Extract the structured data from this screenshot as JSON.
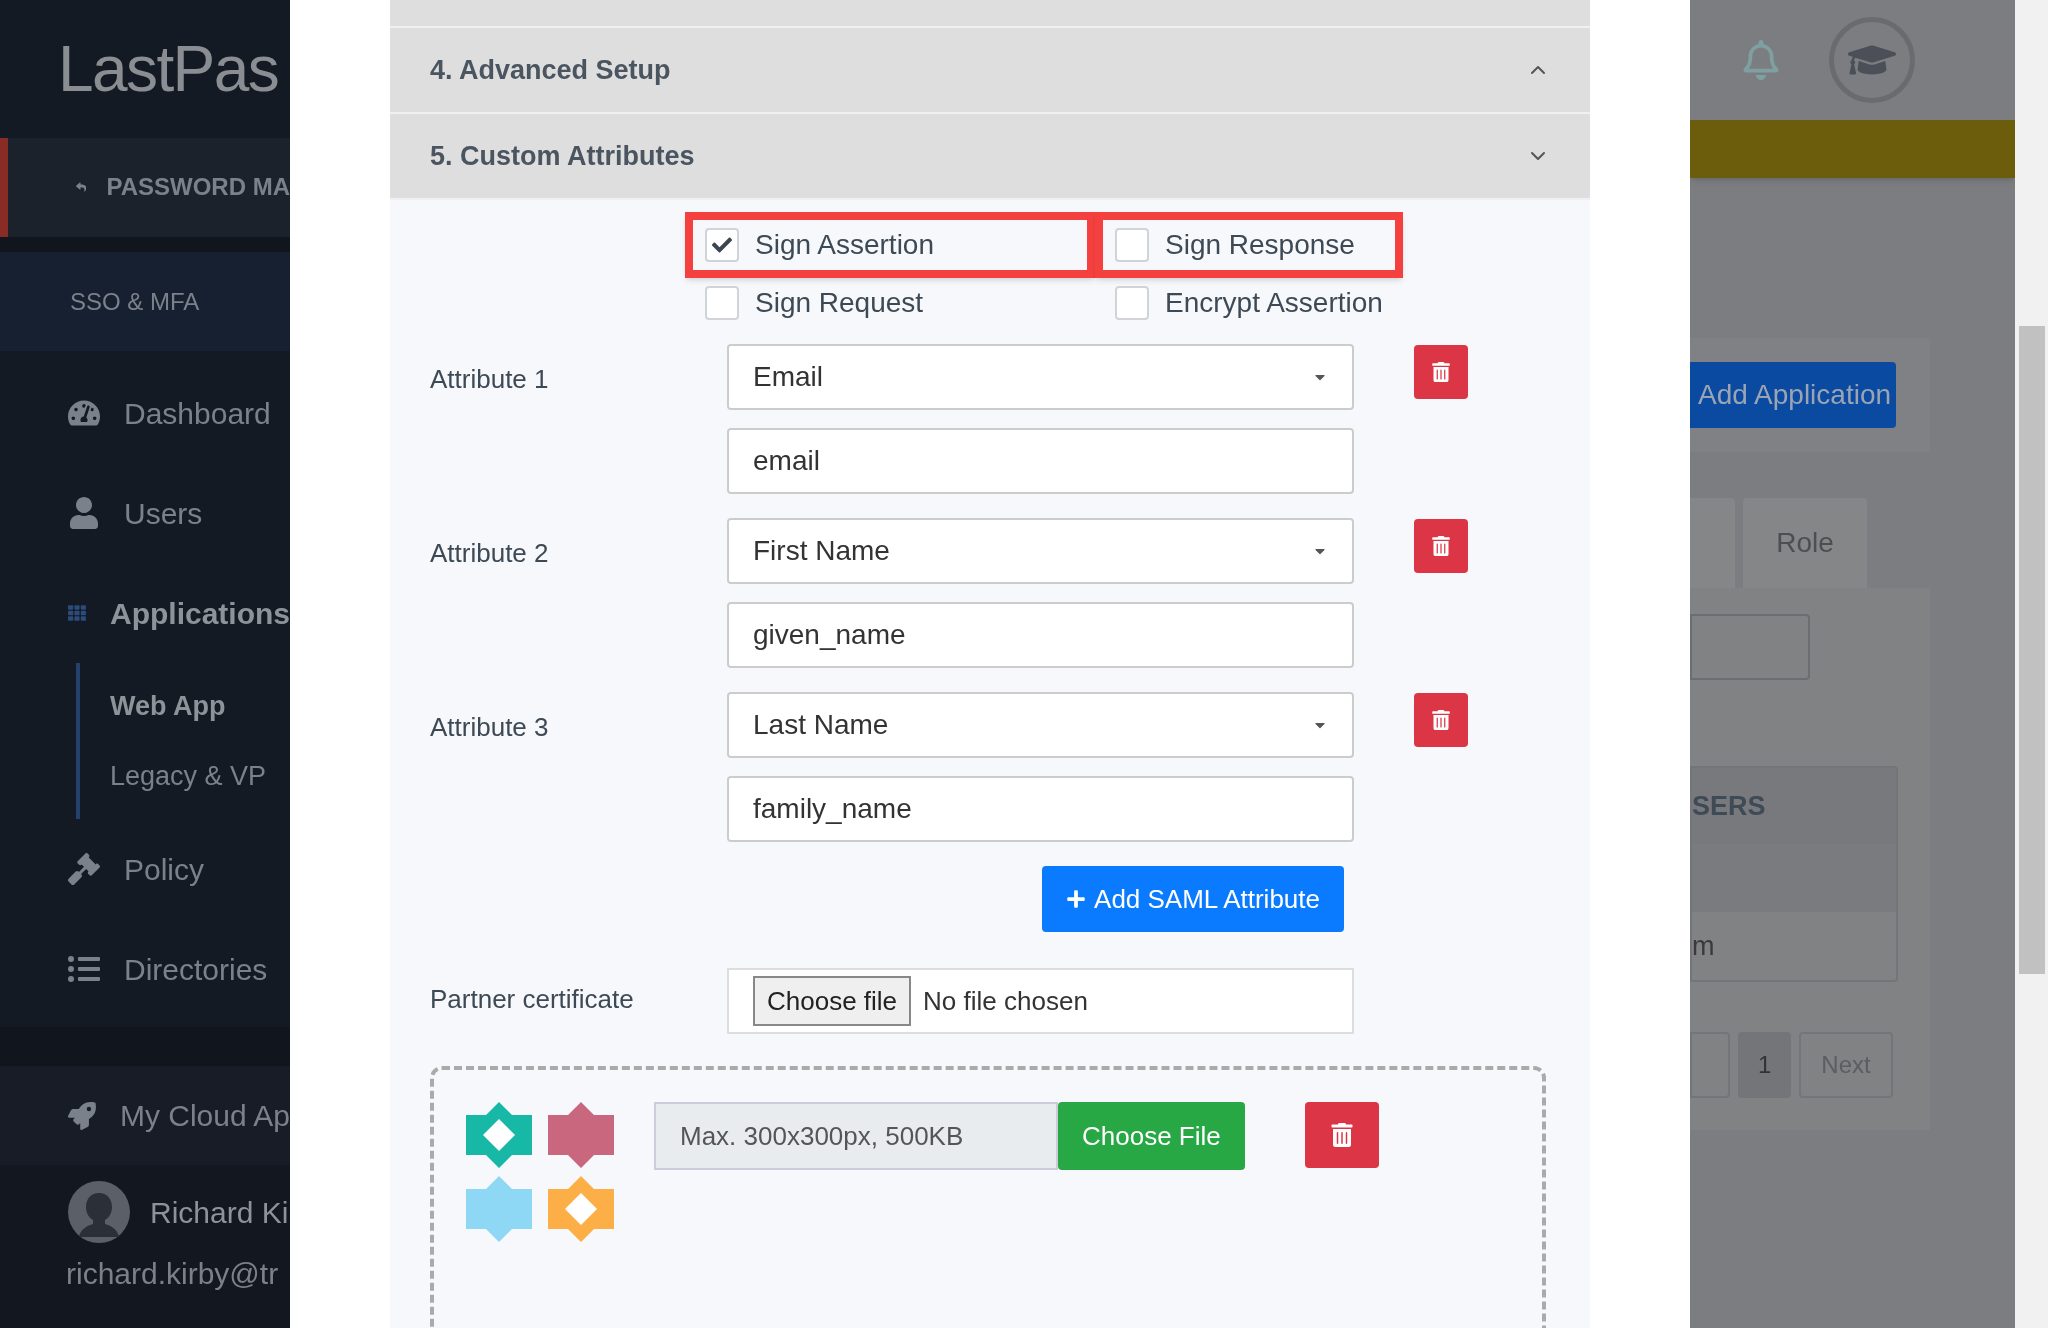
{
  "sidebar": {
    "logo": "LastPas",
    "back_item": "PASSWORD MA",
    "section": "SSO & MFA",
    "items": [
      {
        "label": "Dashboard",
        "selected": false
      },
      {
        "label": "Users",
        "selected": false
      },
      {
        "label": "Applications",
        "selected": true,
        "children": [
          {
            "label": "Web App",
            "selected": true
          },
          {
            "label": "Legacy & VP",
            "selected": false
          }
        ]
      },
      {
        "label": "Policy",
        "selected": false
      },
      {
        "label": "Directories",
        "selected": false
      }
    ],
    "cloud_item": "My Cloud Ap",
    "user": {
      "name": "Richard Ki",
      "email": "richard.kirby@tr"
    }
  },
  "modal": {
    "sections": [
      {
        "title": "4. Advanced Setup",
        "expanded": false
      },
      {
        "title": "5. Custom Attributes",
        "expanded": true
      }
    ],
    "options": [
      {
        "label": "Sign Assertion",
        "checked": true,
        "highlighted": true
      },
      {
        "label": "Sign Response",
        "checked": false,
        "highlighted": true
      },
      {
        "label": "Sign Request",
        "checked": false,
        "highlighted": false
      },
      {
        "label": "Encrypt Assertion",
        "checked": false,
        "highlighted": false
      }
    ],
    "attributes": [
      {
        "label": "Attribute 1",
        "select": "Email",
        "value": "email"
      },
      {
        "label": "Attribute 2",
        "select": "First Name",
        "value": "given_name"
      },
      {
        "label": "Attribute 3",
        "select": "Last Name",
        "value": "family_name"
      }
    ],
    "add_button": "Add SAML Attribute",
    "certificate": {
      "label": "Partner certificate",
      "button": "Choose file",
      "status": "No file chosen"
    },
    "logo_upload": {
      "hint": "Max. 300x300px, 500KB",
      "button": "Choose File"
    }
  },
  "background": {
    "add_button": "Add Application",
    "tab": "Role",
    "table_header": "SERS",
    "cell": "m",
    "pages": [
      {
        "label": "1",
        "selected": true
      },
      {
        "label": "Next",
        "selected": false
      }
    ]
  }
}
